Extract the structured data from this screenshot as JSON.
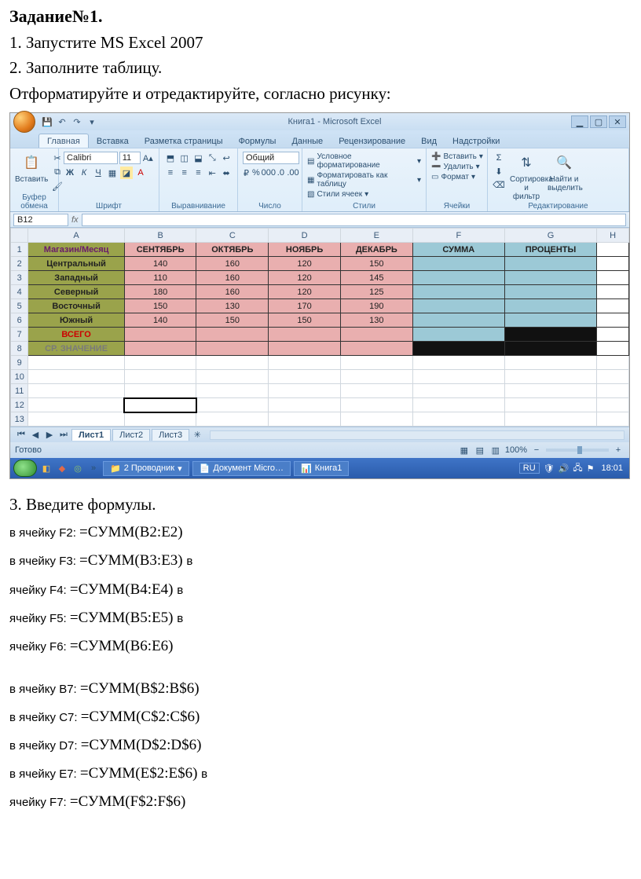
{
  "doc": {
    "task_title": "Задание№1.",
    "line1": "1. Запустите MS Excel 2007",
    "line2": "2. Заполните таблицу.",
    "line3": "Отформатируйте и отредактируйте, согласно рисунку:",
    "line_formulas": "3. Введите формулы."
  },
  "excel": {
    "title": "Книга1 - Microsoft Excel",
    "tabs": [
      "Главная",
      "Вставка",
      "Разметка страницы",
      "Формулы",
      "Данные",
      "Рецензирование",
      "Вид",
      "Надстройки"
    ],
    "active_tab": 0,
    "clipboard": {
      "paste": "Вставить",
      "group": "Буфер обмена"
    },
    "font": {
      "name": "Calibri",
      "size": "11",
      "group": "Шрифт"
    },
    "align": {
      "group": "Выравнивание"
    },
    "number": {
      "format": "Общий",
      "group": "Число"
    },
    "styles": {
      "cond": "Условное форматирование",
      "table": "Форматировать как таблицу",
      "cell": "Стили ячеек",
      "group": "Стили"
    },
    "cells": {
      "insert": "Вставить",
      "delete": "Удалить",
      "format": "Формат",
      "group": "Ячейки"
    },
    "editing": {
      "sort": "Сортировка и фильтр",
      "find": "Найти и выделить",
      "group": "Редактирование"
    },
    "namebox": "B12",
    "columns": [
      "",
      "A",
      "B",
      "C",
      "D",
      "E",
      "F",
      "G",
      "H"
    ],
    "rows": [
      {
        "n": "1",
        "a": "Магазин/Месяц",
        "b": "СЕНТЯБРЬ",
        "c": "ОКТЯБРЬ",
        "d": "НОЯБРЬ",
        "e": "ДЕКАБРЬ",
        "f": "СУММА",
        "g": "ПРОЦЕНТЫ"
      },
      {
        "n": "2",
        "a": "Центральный",
        "b": "140",
        "c": "160",
        "d": "120",
        "e": "150"
      },
      {
        "n": "3",
        "a": "Западный",
        "b": "110",
        "c": "160",
        "d": "120",
        "e": "145"
      },
      {
        "n": "4",
        "a": "Северный",
        "b": "180",
        "c": "160",
        "d": "120",
        "e": "125"
      },
      {
        "n": "5",
        "a": "Восточный",
        "b": "150",
        "c": "130",
        "d": "170",
        "e": "190"
      },
      {
        "n": "6",
        "a": "Южный",
        "b": "140",
        "c": "150",
        "d": "150",
        "e": "130"
      },
      {
        "n": "7",
        "a": "ВСЕГО"
      },
      {
        "n": "8",
        "a": "СР. ЗНАЧЕНИЕ"
      }
    ],
    "sheets": [
      "Лист1",
      "Лист2",
      "Лист3"
    ],
    "status": "Готово",
    "zoom": "100%"
  },
  "taskbar": {
    "items": [
      "2 Проводник",
      "Документ Micro…",
      "Книга1"
    ],
    "lang": "RU",
    "time": "18:01"
  },
  "formulas": [
    {
      "pre": "в ячейку F2: ",
      "f": "=СУММ(B2:E2)"
    },
    {
      "pre": "в ячейку F3: ",
      "f": "=СУММ(B3:E3) ",
      "post": "в"
    },
    {
      "pre": "ячейку F4: ",
      "f": "=СУММ(B4:E4) ",
      "post": "в"
    },
    {
      "pre": "ячейку F5: ",
      "f": "=СУММ(B5:E5) ",
      "post": "в"
    },
    {
      "pre": "ячейку F6: ",
      "f": "=СУММ(B6:E6)"
    },
    {
      "spacer": true
    },
    {
      "pre": "в ячейку B7: ",
      "f": "=СУММ(B$2:B$6)"
    },
    {
      "pre": "в ячейку C7: ",
      "f": "=СУММ(C$2:C$6)"
    },
    {
      "pre": "в ячейку D7: ",
      "f": "=СУММ(D$2:D$6)"
    },
    {
      "pre": "в ячейку E7: ",
      "f": "=СУММ(E$2:E$6) ",
      "post": "в"
    },
    {
      "pre": "ячейку F7: ",
      "f": "=СУММ(F$2:F$6)"
    }
  ]
}
